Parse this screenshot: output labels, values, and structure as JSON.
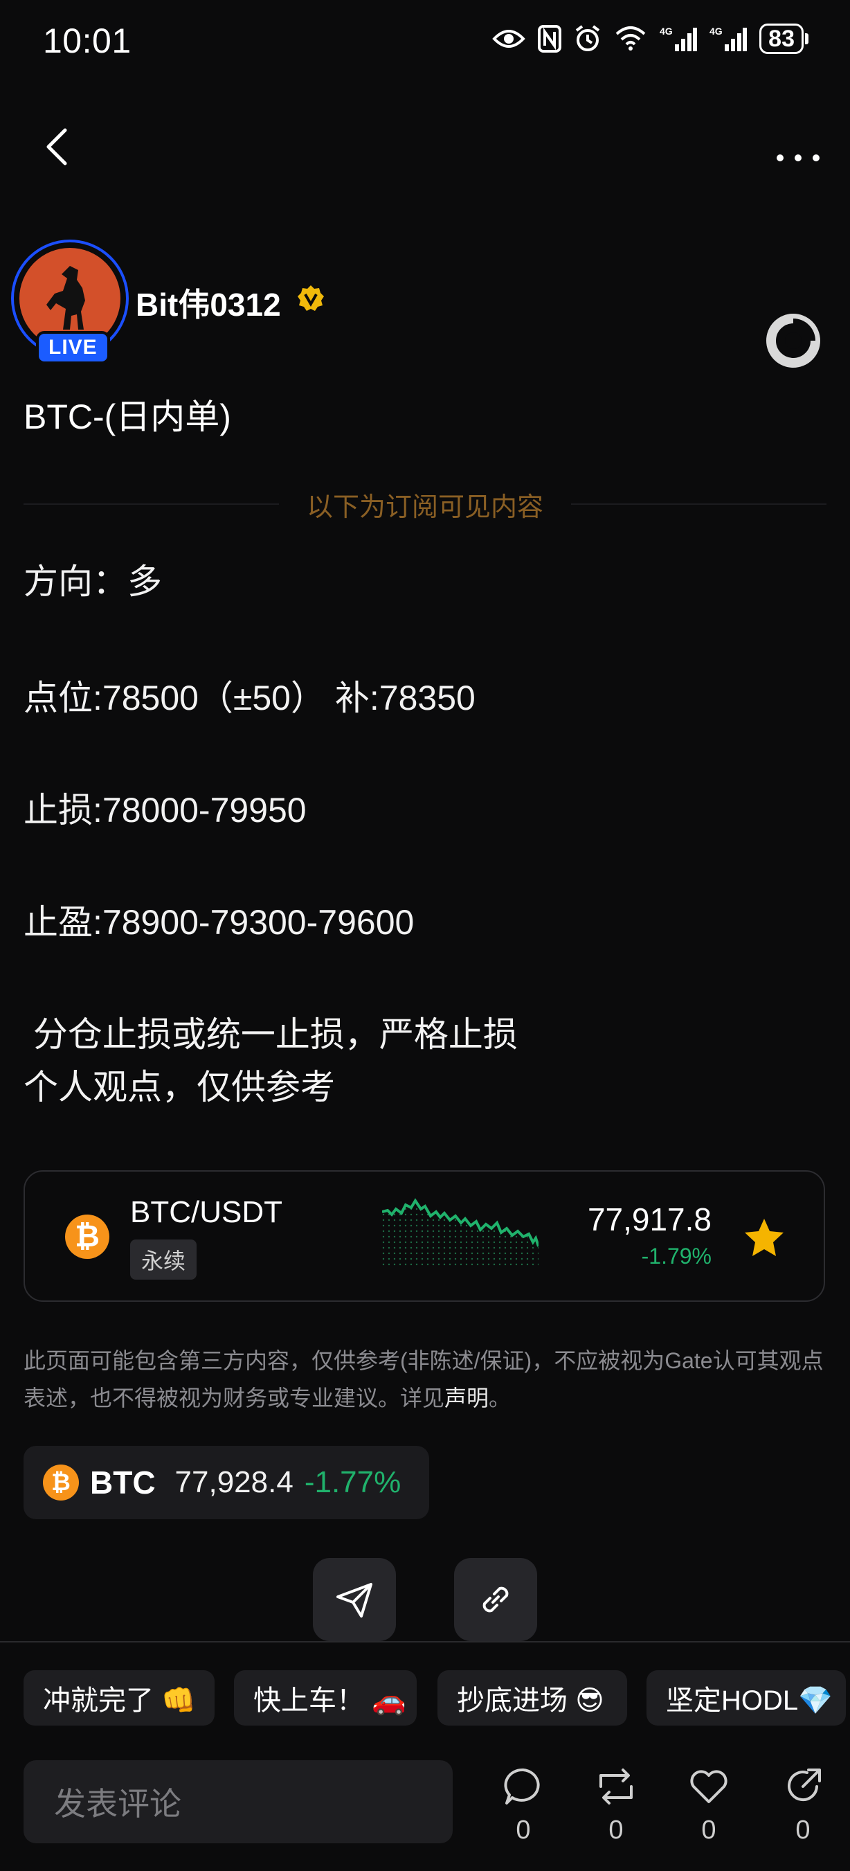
{
  "status_bar": {
    "time": "10:01",
    "battery": "83",
    "net1": "4G",
    "net2": "4G"
  },
  "author": {
    "name": "Bit伟0312",
    "live_badge": "LIVE"
  },
  "post": {
    "title": "BTC-(日内单)",
    "subscriber_notice": "以下为订阅可见内容",
    "lines": [
      "方向：多",
      "点位:78500（±50） 补:78350",
      "止损:78000-79950",
      "止盈:78900-79300-79600",
      " 分仓止损或统一止损，严格止损",
      "个人观点，仅供参考"
    ]
  },
  "market_card": {
    "pair": "BTC/USDT",
    "tag": "永续",
    "price": "77,917.8",
    "change": "-1.79%",
    "coin_icon": "bitcoin-icon",
    "favorite_icon": "star-icon"
  },
  "disclaimer": {
    "text": "此页面可能包含第三方内容，仅供参考(非陈述/保证)，不应被视为Gate认可其观点表述，也不得被视为财务或专业建议。详见",
    "link": "声明",
    "end": "。"
  },
  "ticker": {
    "symbol": "BTC",
    "price": "77,928.4",
    "change": "-1.77%"
  },
  "quick_replies": [
    "冲就完了 👊",
    "快上车！ 🚗",
    "抄底进场 😎",
    "坚定HODL💎"
  ],
  "comment": {
    "placeholder": "发表评论"
  },
  "actions": {
    "comments": "0",
    "reposts": "0",
    "likes": "0",
    "shares": "0"
  },
  "colors": {
    "positive": "#20b26c",
    "subscriber": "#8a5f24",
    "brand_live": "#1b5cff"
  }
}
